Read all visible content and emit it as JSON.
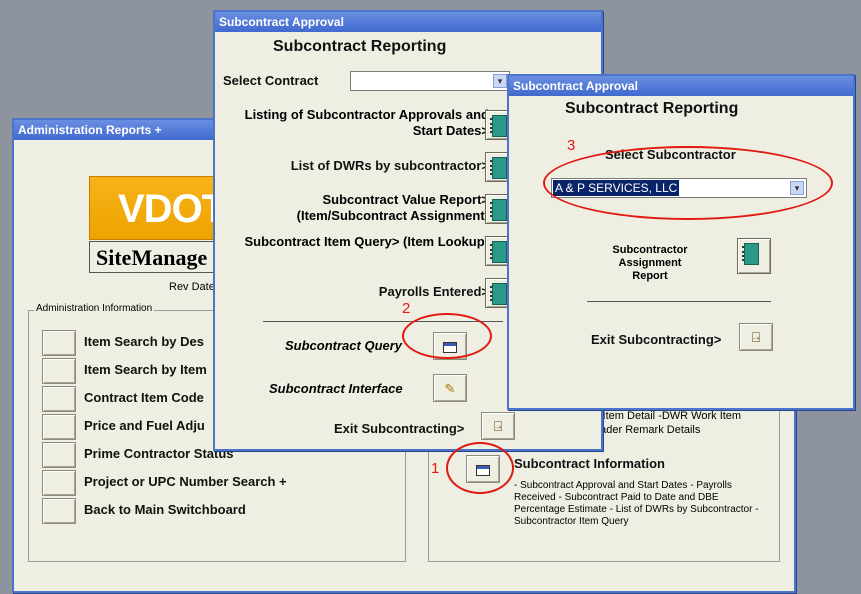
{
  "admin_window": {
    "title": "Administration Reports +",
    "logo_text": "VDOT",
    "app_name": "SiteManage",
    "rev_date": "Rev Date",
    "group_title": "Administration Information",
    "menu": [
      "Item Search by Des",
      "Item Search by Item",
      "Contract Item Code",
      "Price and Fuel Adju",
      "Prime Contractor Status",
      "Project or UPC Number Search +",
      "Back to Main Switchboard"
    ],
    "right_text_1": "k Item Detail -DWR Work Item",
    "right_text_2": "eader Remark Details",
    "subcontract_info_title": "Subcontract Information",
    "subcontract_info_desc": "- Subcontract Approval and Start Dates - Payrolls Received - Subcontract Paid to Date and DBE Percentage Estimate - List of DWRs by Subcontractor - Subcontractor Item Query"
  },
  "window2": {
    "title": "Subcontract Approval",
    "heading": "Subcontract Reporting",
    "select_label": "Select Contract",
    "select_value": "",
    "reports": [
      "Listing of Subcontractor Approvals and Start Dates>",
      "List of DWRs by subcontractor>",
      "Subcontract Value Report> (Item/Subcontract Assignment)",
      "Subcontract Item Query> (Item Lookup)",
      "Payrolls Entered>"
    ],
    "query_label": "Subcontract Query",
    "interface_label": "Subcontract Interface",
    "exit_label": "Exit Subcontracting>"
  },
  "window3": {
    "title": "Subcontract Approval",
    "heading": "Subcontract Reporting",
    "select_label": "Select Subcontractor",
    "select_value": "A & P SERVICES, LLC",
    "assign_label": "Subcontractor Assignment Report",
    "exit_label": "Exit Subcontracting>"
  },
  "annotations": {
    "n1": "1",
    "n2": "2",
    "n3": "3"
  },
  "colors": {
    "titlebar": "#4169cf",
    "window_bg": "#efeee3",
    "annotation": "#e01a10",
    "selection": "#0a246a"
  }
}
